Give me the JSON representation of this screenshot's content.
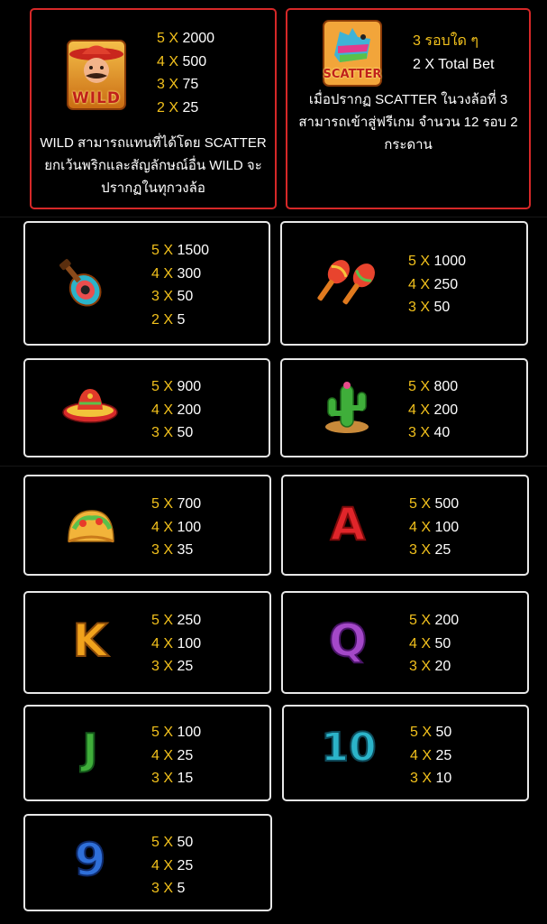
{
  "wild": {
    "badge": "WILD",
    "pays": [
      {
        "count": "5",
        "amount": "2000"
      },
      {
        "count": "4",
        "amount": "500"
      },
      {
        "count": "3",
        "amount": "75"
      },
      {
        "count": "2",
        "amount": "25"
      }
    ],
    "desc": [
      "WILD สามารถแทนที่ได้โดย SCATTER",
      "ยกเว้นพริกและสัญลักษณ์อื่น WILD จะ",
      "ปรากฏในทุกวงล้อ"
    ]
  },
  "scatter": {
    "badge": "SCATTER",
    "line1": "3 รอบใด ๆ",
    "line2": "2 X Total Bet",
    "desc": [
      "เมื่อปรากฏ SCATTER ในวงล้อที่ 3",
      "สามารถเข้าสู่ฟรีเกม จำนวน 12 รอบ 2",
      "กระดาน"
    ]
  },
  "symbols": [
    {
      "name": "guitar",
      "pays": [
        {
          "count": "5",
          "amount": "1500"
        },
        {
          "count": "4",
          "amount": "300"
        },
        {
          "count": "3",
          "amount": "50"
        },
        {
          "count": "2",
          "amount": "5"
        }
      ]
    },
    {
      "name": "maracas",
      "pays": [
        {
          "count": "5",
          "amount": "1000"
        },
        {
          "count": "4",
          "amount": "250"
        },
        {
          "count": "3",
          "amount": "50"
        }
      ]
    },
    {
      "name": "sombrero",
      "pays": [
        {
          "count": "5",
          "amount": "900"
        },
        {
          "count": "4",
          "amount": "200"
        },
        {
          "count": "3",
          "amount": "50"
        }
      ]
    },
    {
      "name": "cactus",
      "pays": [
        {
          "count": "5",
          "amount": "800"
        },
        {
          "count": "4",
          "amount": "200"
        },
        {
          "count": "3",
          "amount": "40"
        }
      ]
    },
    {
      "name": "taco",
      "pays": [
        {
          "count": "5",
          "amount": "700"
        },
        {
          "count": "4",
          "amount": "100"
        },
        {
          "count": "3",
          "amount": "35"
        }
      ]
    },
    {
      "name": "A",
      "pays": [
        {
          "count": "5",
          "amount": "500"
        },
        {
          "count": "4",
          "amount": "100"
        },
        {
          "count": "3",
          "amount": "25"
        }
      ]
    },
    {
      "name": "K",
      "pays": [
        {
          "count": "5",
          "amount": "250"
        },
        {
          "count": "4",
          "amount": "100"
        },
        {
          "count": "3",
          "amount": "25"
        }
      ]
    },
    {
      "name": "Q",
      "pays": [
        {
          "count": "5",
          "amount": "200"
        },
        {
          "count": "4",
          "amount": "50"
        },
        {
          "count": "3",
          "amount": "20"
        }
      ]
    },
    {
      "name": "J",
      "pays": [
        {
          "count": "5",
          "amount": "100"
        },
        {
          "count": "4",
          "amount": "25"
        },
        {
          "count": "3",
          "amount": "15"
        }
      ]
    },
    {
      "name": "10",
      "pays": [
        {
          "count": "5",
          "amount": "50"
        },
        {
          "count": "4",
          "amount": "25"
        },
        {
          "count": "3",
          "amount": "10"
        }
      ]
    },
    {
      "name": "9",
      "pays": [
        {
          "count": "5",
          "amount": "50"
        },
        {
          "count": "4",
          "amount": "25"
        },
        {
          "count": "3",
          "amount": "5"
        }
      ]
    }
  ],
  "multiplier_sign": "X",
  "colors": {
    "count": "#f2c11c",
    "amount": "#ffffff",
    "special_border": "#d62828",
    "card_border": "#e8e8e8"
  }
}
